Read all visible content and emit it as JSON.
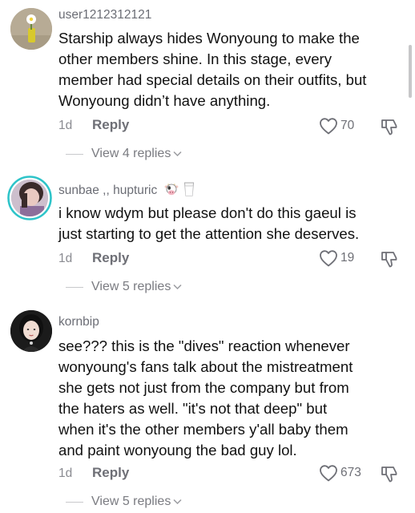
{
  "comments": [
    {
      "username": "user1212312121",
      "lines": [
        "Starship always hides Wonyoung to make the",
        "other members shine. In this stage, every",
        "member had special details on their outfits, but",
        "Wonyoung didn’t have anything."
      ],
      "time": "1d",
      "reply_label": "Reply",
      "likes": "70",
      "view_replies": "View 4 replies"
    },
    {
      "username": "sunbae ,, hupturic",
      "lines": [
        "i know wdym but please don't do this gaeul is",
        "just starting to get the attention she deserves."
      ],
      "time": "1d",
      "reply_label": "Reply",
      "likes": "19",
      "view_replies": "View 5 replies"
    },
    {
      "username": "kornbip",
      "lines": [
        "see??? this is the \"dives\" reaction whenever",
        "wonyoung's fans talk about the mistreatment",
        "she gets not just from the company but from",
        "the haters as well. \"it's not that deep\" but",
        "when it's the other members y'all baby them",
        "and paint wonyoung the bad guy lol."
      ],
      "time": "1d",
      "reply_label": "Reply",
      "likes": "673",
      "view_replies": "View 5 replies"
    }
  ],
  "icons": {
    "like": "heart-outline-icon",
    "dislike": "thumbs-down-icon",
    "expand": "chevron-down-icon",
    "username_emoji": [
      "cow-emoji-icon",
      "milk-glass-emoji-icon"
    ]
  },
  "colors": {
    "text": "#111111",
    "secondary": "#6e6f76",
    "story_ring": "#2ec4c9"
  }
}
